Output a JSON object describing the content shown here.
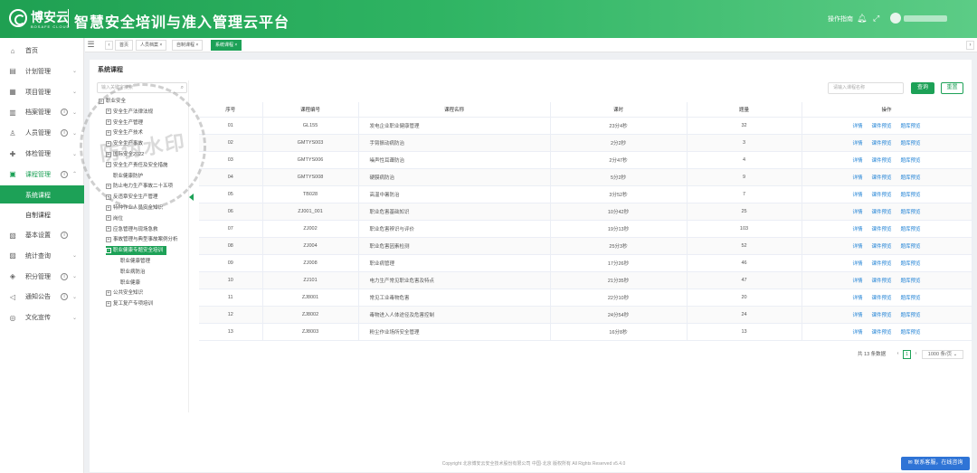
{
  "header": {
    "brand": "博安云",
    "brand_sub": "BOSAFE CLOUD",
    "title": "智慧安全培训与准入管理云平台",
    "guide": "操作指南",
    "icons": [
      "bell-icon",
      "fullscreen-icon"
    ]
  },
  "sidebar": {
    "items": [
      {
        "label": "首页",
        "icon": "home-icon",
        "arrow": "",
        "info": ""
      },
      {
        "label": "计划管理",
        "icon": "plan-icon",
        "arrow": "⌄",
        "info": ""
      },
      {
        "label": "项目管理",
        "icon": "grid-icon",
        "arrow": "⌄",
        "info": ""
      },
      {
        "label": "档案管理",
        "icon": "archive-icon",
        "arrow": "⌄",
        "info": "i"
      },
      {
        "label": "人员管理",
        "icon": "user-icon",
        "arrow": "⌄",
        "info": "i"
      },
      {
        "label": "体检管理",
        "icon": "health-icon",
        "arrow": "⌄",
        "info": ""
      },
      {
        "label": "课程管理",
        "icon": "course-icon",
        "arrow": "⌃",
        "info": "i"
      }
    ],
    "subitems": [
      "系统课程",
      "自制课程"
    ],
    "items2": [
      {
        "label": "基本设置",
        "icon": "settings-icon",
        "arrow": "",
        "info": "i"
      },
      {
        "label": "统计查询",
        "icon": "stats-icon",
        "arrow": "⌄",
        "info": ""
      },
      {
        "label": "积分管理",
        "icon": "points-icon",
        "arrow": "⌄",
        "info": "i"
      },
      {
        "label": "通知公告",
        "icon": "notice-icon",
        "arrow": "⌄",
        "info": "i"
      },
      {
        "label": "文化宣传",
        "icon": "culture-icon",
        "arrow": "⌄",
        "info": ""
      }
    ]
  },
  "tabs": [
    "首页",
    "人员档案",
    "自制课程",
    "系统课程"
  ],
  "panel_title": "系统课程",
  "tree": {
    "placeholder": "输入关键字搜索",
    "nodes": [
      {
        "label": "职业安全",
        "level": 0,
        "box": "−"
      },
      {
        "label": "安全生产法律法规",
        "level": 1,
        "box": "+"
      },
      {
        "label": "安全生产管理",
        "level": 1,
        "box": "+"
      },
      {
        "label": "安全生产技术",
        "level": 1,
        "box": "+"
      },
      {
        "label": "安全生产事故",
        "level": 1,
        "box": "+"
      },
      {
        "label": "国际安全2022",
        "level": 1,
        "box": "+"
      },
      {
        "label": "安全生产责任及安全措施",
        "level": 1,
        "box": "+"
      },
      {
        "label": "职业健康防护",
        "level": 1,
        "box": ""
      },
      {
        "label": "防止电力生产事故二十五项",
        "level": 1,
        "box": "+"
      },
      {
        "label": "反违章安全生产管理",
        "level": 1,
        "box": "+"
      },
      {
        "label": "特种作业人员安全知识",
        "level": 1,
        "box": "+"
      },
      {
        "label": "岗位",
        "level": 1,
        "box": "+"
      },
      {
        "label": "应急管理与现场急救",
        "level": 1,
        "box": "+"
      },
      {
        "label": "事故管理与典型事故案例分析",
        "level": 1,
        "box": "+"
      },
      {
        "label": "职业健康专题安全培训",
        "level": 1,
        "box": "−",
        "selected": true
      },
      {
        "label": "职业健康管理",
        "level": 2,
        "box": ""
      },
      {
        "label": "职业病防治",
        "level": 2,
        "box": ""
      },
      {
        "label": "职业健康",
        "level": 2,
        "box": ""
      },
      {
        "label": "公共安全知识",
        "level": 1,
        "box": "+"
      },
      {
        "label": "复工复产专项培训",
        "level": 1,
        "box": "+"
      }
    ]
  },
  "search": {
    "placeholder": "请输入课程名称",
    "query_label": "查询",
    "reset_label": "重置"
  },
  "table": {
    "headers": [
      "序号",
      "课程编号",
      "课程名称",
      "课时",
      "题量",
      "操作"
    ],
    "ops": [
      "详情",
      "课件预览",
      "题库预览"
    ],
    "rows": [
      [
        "01",
        "GL155",
        "发电企业职业健康管理",
        "23分4秒",
        "32"
      ],
      [
        "02",
        "GMTYS003",
        "手臂振动病防治",
        "2分2秒",
        "3"
      ],
      [
        "03",
        "GMTYS006",
        "噪声性耳聋防治",
        "2分47秒",
        "4"
      ],
      [
        "04",
        "GMTYS008",
        "硬膜病防治",
        "5分2秒",
        "9"
      ],
      [
        "05",
        "TB028",
        "高温中暑防治",
        "3分52秒",
        "7"
      ],
      [
        "06",
        "ZJ001_001",
        "职业危害基础知识",
        "10分42秒",
        "25"
      ],
      [
        "07",
        "ZJ002",
        "职业危害辨识与评价",
        "19分13秒",
        "103"
      ],
      [
        "08",
        "ZJ004",
        "职业危害因素检测",
        "25分3秒",
        "52"
      ],
      [
        "09",
        "ZJ008",
        "职业病管理",
        "17分26秒",
        "46"
      ],
      [
        "10",
        "ZJ101",
        "电力生产常见职业危害及特点",
        "21分35秒",
        "47"
      ],
      [
        "11",
        "ZJ8001",
        "常见工业毒物危害",
        "22分10秒",
        "20"
      ],
      [
        "12",
        "ZJ8002",
        "毒物进入人体途径及危害控制",
        "24分54秒",
        "24"
      ],
      [
        "13",
        "ZJ8003",
        "粉尘作业场所安全管理",
        "16分8秒",
        "13"
      ]
    ]
  },
  "pager": {
    "total": "共 13 条数据",
    "page": "1",
    "size": "1000 条/页",
    "prev": "‹",
    "next": "›"
  },
  "footer": "Copyright 北京博安云安全技术股份有限公司 中国·北京 版权所有 All Rights Reserved v5.4.0",
  "contact": "联系客服，在线咨询",
  "watermark": "防伪水印",
  "colors": {
    "brand": "#1da157",
    "link": "#1b7fd4",
    "contact": "#2f74d6"
  }
}
